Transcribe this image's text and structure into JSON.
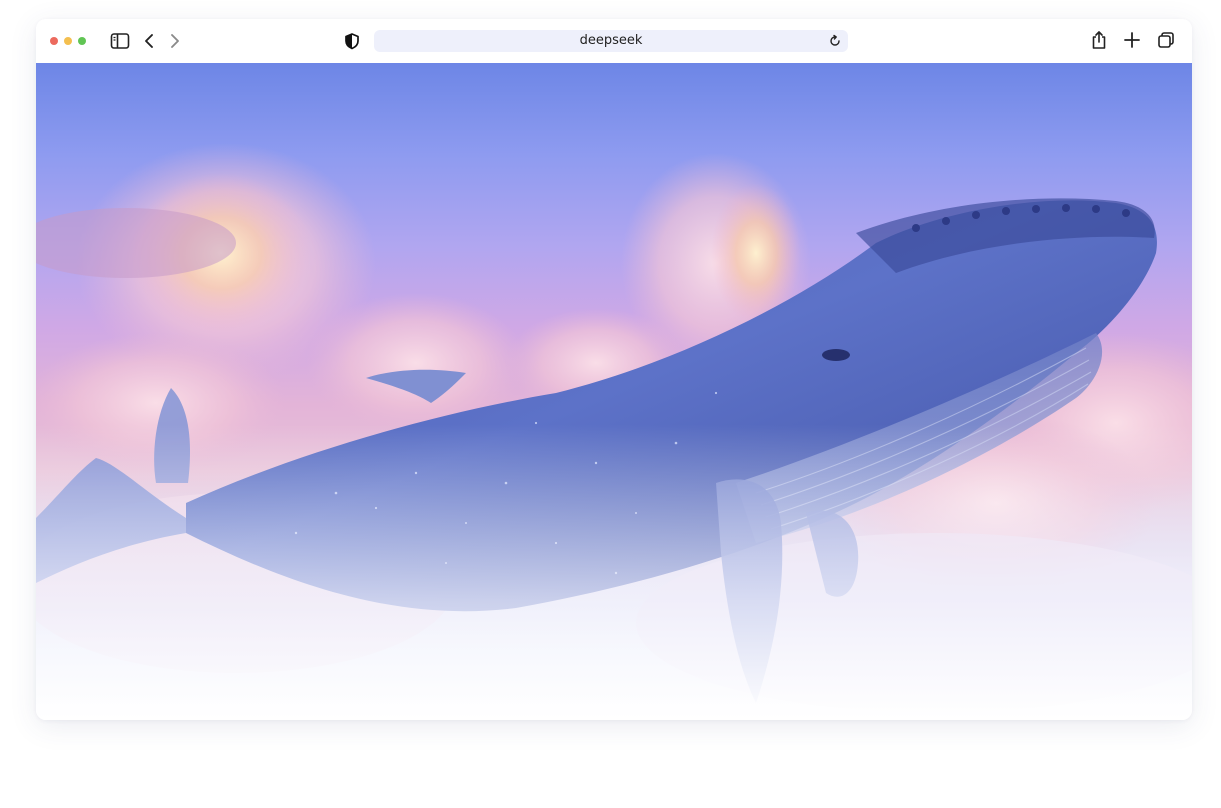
{
  "browser": {
    "address_bar": {
      "url": "deepseek"
    },
    "icons": {
      "traffic_lights": [
        "close",
        "minimize",
        "zoom"
      ],
      "sidebar": "sidebar-icon",
      "back": "chevron-left-icon",
      "forward": "chevron-right-icon",
      "privacy": "shield-icon",
      "reload": "reload-icon",
      "share": "share-icon",
      "new_tab": "plus-icon",
      "tabs": "tab-overview-icon"
    },
    "colors": {
      "close": "#ec6a5e",
      "minimize": "#f4bf4f",
      "zoom": "#61c554",
      "address_bg": "#eef0fb"
    }
  },
  "page": {
    "hero_image": "whale-in-clouds"
  }
}
